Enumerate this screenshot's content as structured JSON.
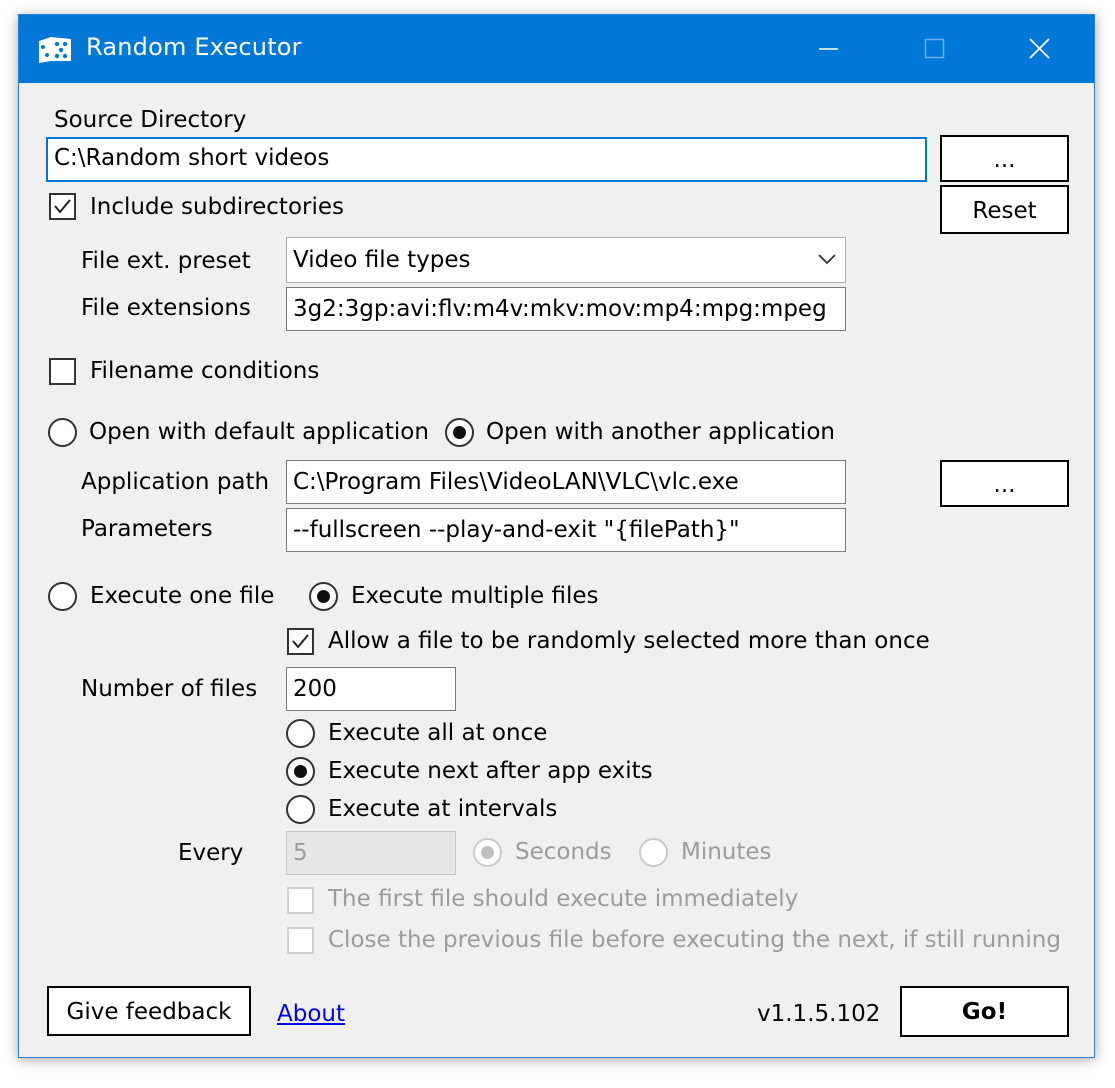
{
  "window": {
    "title": "Random Executor",
    "accent": "#0078d7"
  },
  "source": {
    "label": "Source Directory",
    "path": "C:\\Random short videos",
    "browse_label": "...",
    "reset_label": "Reset",
    "include_subdirs_label": "Include subdirectories",
    "include_subdirs_checked": true
  },
  "extensions": {
    "preset_label": "File ext. preset",
    "preset_value": "Video file types",
    "extensions_label": "File extensions",
    "extensions_value": "3g2:3gp:avi:flv:m4v:mkv:mov:mp4:mpg:mpeg"
  },
  "filename_conditions": {
    "label": "Filename conditions",
    "checked": false
  },
  "open_with": {
    "default_label": "Open with default application",
    "another_label": "Open with another application",
    "selected": "another",
    "app_path_label": "Application path",
    "app_path_value": "C:\\Program Files\\VideoLAN\\VLC\\vlc.exe",
    "app_browse_label": "...",
    "params_label": "Parameters",
    "params_value": "--fullscreen --play-and-exit \"{filePath}\""
  },
  "execute": {
    "one_label": "Execute one file",
    "multiple_label": "Execute multiple files",
    "selected": "multiple",
    "allow_repeat_label": "Allow a file to be randomly selected more than once",
    "allow_repeat_checked": true,
    "number_label": "Number of files",
    "number_value": "200",
    "all_at_once_label": "Execute all at once",
    "next_after_exit_label": "Execute next after app exits",
    "at_intervals_label": "Execute at intervals",
    "mode_selected": "next_after_exit",
    "every_label": "Every",
    "every_value": "5",
    "seconds_label": "Seconds",
    "minutes_label": "Minutes",
    "unit_selected": "seconds",
    "first_immediate_label": "The first file should execute immediately",
    "close_previous_label": "Close the previous file before executing the next, if still running"
  },
  "footer": {
    "feedback_label": "Give feedback",
    "about_label": "About",
    "version": "v1.1.5.102",
    "go_label": "Go!"
  }
}
